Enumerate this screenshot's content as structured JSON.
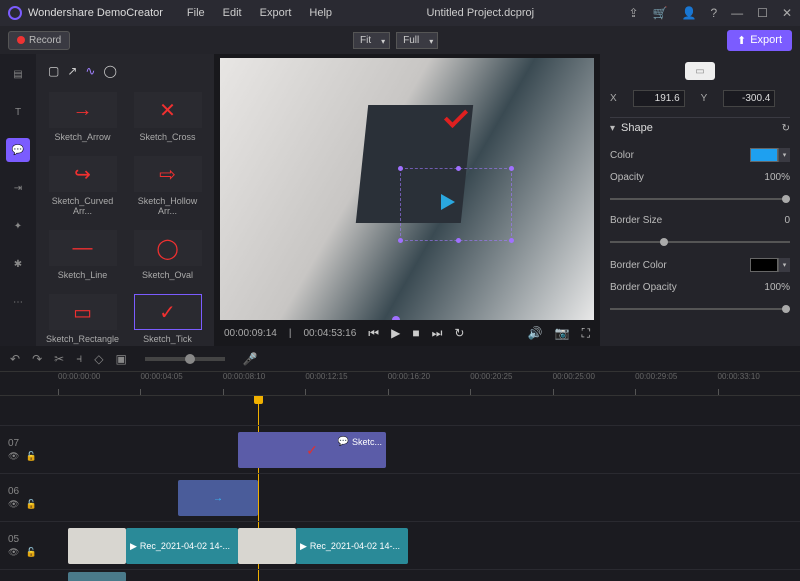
{
  "app": {
    "name": "Wondershare DemoCreator",
    "project": "Untitled Project.dcproj"
  },
  "menu": {
    "file": "File",
    "edit": "Edit",
    "export": "Export",
    "help": "Help"
  },
  "record": "Record",
  "fit": "Fit",
  "full": "Full",
  "export_btn": "Export",
  "shapes": [
    {
      "k": "arrow",
      "label": "Sketch_Arrow",
      "glyph": "→"
    },
    {
      "k": "cross",
      "label": "Sketch_Cross",
      "glyph": "✕"
    },
    {
      "k": "curved",
      "label": "Sketch_Curved Arr...",
      "glyph": "↪"
    },
    {
      "k": "hollow",
      "label": "Sketch_Hollow Arr...",
      "glyph": "⇨"
    },
    {
      "k": "line",
      "label": "Sketch_Line",
      "glyph": "—"
    },
    {
      "k": "oval",
      "label": "Sketch_Oval",
      "glyph": "◯"
    },
    {
      "k": "rect",
      "label": "Sketch_Rectangle",
      "glyph": "▭"
    },
    {
      "k": "tick",
      "label": "Sketch_Tick",
      "glyph": "✓",
      "selected": true
    }
  ],
  "preview": {
    "current": "00:00:09:14",
    "total": "00:04:53:16"
  },
  "props": {
    "x_label": "X",
    "x": "191.6",
    "y_label": "Y",
    "y": "-300.4",
    "shape_hdr": "Shape",
    "color_label": "Color",
    "opacity_label": "Opacity",
    "opacity_val": "100%",
    "border_size_label": "Border Size",
    "border_size_val": "0",
    "border_color_label": "Border Color",
    "border_opacity_label": "Border Opacity",
    "border_opacity_val": "100%"
  },
  "ruler": [
    "00:00:00:00",
    "00:00:04:05",
    "00:00:08:10",
    "00:00:12:15",
    "00:00:16:20",
    "00:00:20:25",
    "00:00:25:00",
    "00:00:29:05",
    "00:00:33:10"
  ],
  "tracks": {
    "t07": "07",
    "t06": "06",
    "t05": "05",
    "sketch_clip": "Sketc...",
    "rec_clip": "Rec_2021-04-02 14-..."
  }
}
